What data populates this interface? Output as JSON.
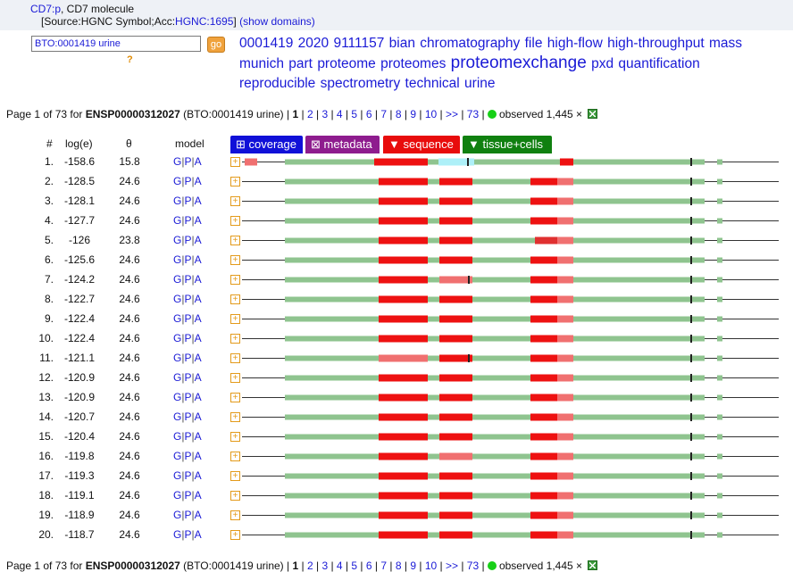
{
  "header": {
    "gene_link": "CD7:p",
    "gene_desc": ", CD7 molecule",
    "source_prefix": "[Source:HGNC Symbol;Acc:",
    "source_link": "HGNC:1695",
    "source_suffix": "]",
    "show_domains": "(show domains)"
  },
  "search": {
    "value": "BTO:0001419 urine",
    "go_label": "go",
    "help": "?"
  },
  "keywords": [
    {
      "text": "0001419",
      "big": false
    },
    {
      "text": "2020",
      "big": false
    },
    {
      "text": "9111157",
      "big": false
    },
    {
      "text": "bian",
      "big": false
    },
    {
      "text": "chromatography",
      "big": false
    },
    {
      "text": "file",
      "big": false
    },
    {
      "text": "high-flow",
      "big": false
    },
    {
      "text": "high-throughput",
      "big": false
    },
    {
      "text": "mass",
      "big": false
    },
    {
      "text": "munich",
      "big": false
    },
    {
      "text": "part",
      "big": false
    },
    {
      "text": "proteome",
      "big": false
    },
    {
      "text": "proteomes",
      "big": false
    },
    {
      "text": "proteomexchange",
      "big": true
    },
    {
      "text": "pxd",
      "big": false
    },
    {
      "text": "quantification",
      "big": false
    },
    {
      "text": "reproducible",
      "big": false
    },
    {
      "text": "spectrometry",
      "big": false
    },
    {
      "text": "technical",
      "big": false
    },
    {
      "text": "urine",
      "big": false
    }
  ],
  "pager": {
    "prefix": "Page 1 of 73 for ",
    "protein": "ENSP00000312027",
    "context": " (BTO:0001419 urine) | ",
    "current": "1",
    "pages": [
      "2",
      "3",
      "4",
      "5",
      "6",
      "7",
      "8",
      "9",
      "10",
      ">>",
      "73"
    ],
    "observed": "observed 1,445 ×"
  },
  "columns": {
    "num": "#",
    "loge": "log(e)",
    "theta": "θ",
    "model": "model"
  },
  "tabs": {
    "coverage": "⊞ coverage",
    "metadata": "⊠ metadata",
    "sequence": "▼ sequence",
    "tissue": "▼ tissue+cells"
  },
  "model_links": [
    "G",
    "P",
    "A"
  ],
  "expand_glyph": "+",
  "colors": {
    "header_band": "#eef1f6",
    "link": "#1a1ad6",
    "coverage_green": "#8fc48f",
    "peptide_red": "#ee1111",
    "peptide_light": "#f07070",
    "highlight_cyan": "#aef0f8",
    "observed_dot": "#17d017"
  },
  "rows": [
    {
      "num": "1.",
      "loge": "-158.6",
      "theta": "15.8"
    },
    {
      "num": "2.",
      "loge": "-128.5",
      "theta": "24.6"
    },
    {
      "num": "3.",
      "loge": "-128.1",
      "theta": "24.6"
    },
    {
      "num": "4.",
      "loge": "-127.7",
      "theta": "24.6"
    },
    {
      "num": "5.",
      "loge": "-126",
      "theta": "23.8"
    },
    {
      "num": "6.",
      "loge": "-125.6",
      "theta": "24.6"
    },
    {
      "num": "7.",
      "loge": "-124.2",
      "theta": "24.6"
    },
    {
      "num": "8.",
      "loge": "-122.7",
      "theta": "24.6"
    },
    {
      "num": "9.",
      "loge": "-122.4",
      "theta": "24.6"
    },
    {
      "num": "10.",
      "loge": "-122.4",
      "theta": "24.6"
    },
    {
      "num": "11.",
      "loge": "-121.1",
      "theta": "24.6"
    },
    {
      "num": "12.",
      "loge": "-120.9",
      "theta": "24.6"
    },
    {
      "num": "13.",
      "loge": "-120.9",
      "theta": "24.6"
    },
    {
      "num": "14.",
      "loge": "-120.7",
      "theta": "24.6"
    },
    {
      "num": "15.",
      "loge": "-120.4",
      "theta": "24.6"
    },
    {
      "num": "16.",
      "loge": "-119.8",
      "theta": "24.6"
    },
    {
      "num": "17.",
      "loge": "-119.3",
      "theta": "24.6"
    },
    {
      "num": "18.",
      "loge": "-119.1",
      "theta": "24.6"
    },
    {
      "num": "19.",
      "loge": "-118.9",
      "theta": "24.6"
    },
    {
      "num": "20.",
      "loge": "-118.7",
      "theta": "24.6"
    }
  ]
}
